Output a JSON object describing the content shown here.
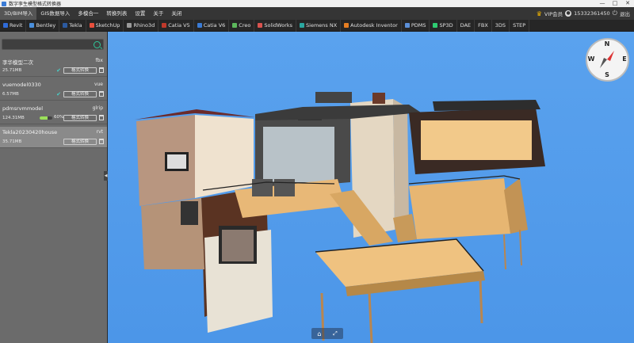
{
  "window": {
    "title": "数字孪生模型格式转换器",
    "controls": [
      "—",
      "□",
      "✕"
    ]
  },
  "menu": {
    "items": [
      "3D/BIM导入",
      "GIS数据导入",
      "多模合一",
      "转换列表",
      "设置",
      "关于",
      "关闭"
    ],
    "vip_label": "VIP会员",
    "phone": "15332361450",
    "logout": "退出"
  },
  "toolbar": {
    "items": [
      {
        "label": "Revit",
        "color": "#2f6bd8"
      },
      {
        "label": "Bentley",
        "color": "#4a8fdc"
      },
      {
        "label": "Tekla",
        "color": "#2c5aa0"
      },
      {
        "label": "SketchUp",
        "color": "#e84f3c"
      },
      {
        "label": "Rhino3d",
        "color": "#9a9a9a"
      },
      {
        "label": "Catia V5",
        "color": "#c0392b"
      },
      {
        "label": "Catia V6",
        "color": "#3a7bd5"
      },
      {
        "label": "Creo",
        "color": "#5cb85c"
      },
      {
        "label": "SolidWorks",
        "color": "#d9534f"
      },
      {
        "label": "Siemens NX",
        "color": "#2aa7a0"
      },
      {
        "label": "Autodesk Inventor",
        "color": "#e67e22"
      },
      {
        "label": "PDMS",
        "color": "#5b8fd8"
      },
      {
        "label": "SP3D",
        "color": "#2ecc71"
      },
      {
        "label": "DAE",
        "color": ""
      },
      {
        "label": "FBX",
        "color": ""
      },
      {
        "label": "3DS",
        "color": ""
      },
      {
        "label": "STEP",
        "color": ""
      }
    ]
  },
  "sidebar": {
    "search": {
      "placeholder": "",
      "value": ""
    },
    "convert_label": "格式转换",
    "models": [
      {
        "name": "李华模型二次",
        "ext": "fbx",
        "size": "25.71MB",
        "progress": null,
        "selected": false
      },
      {
        "name": "vuemodel0330",
        "ext": "vue",
        "size": "6.57MB",
        "progress": null,
        "selected": false
      },
      {
        "name": "pdmsrvmmodel",
        "ext": "glrip",
        "size": "124.31MB",
        "progress": 60,
        "progress_label": "60%",
        "selected": false
      },
      {
        "name": "Tekla20230420house",
        "ext": "rvt",
        "size": "35.71MB",
        "progress": null,
        "selected": true
      }
    ]
  },
  "compass": {
    "n": "N",
    "e": "E",
    "s": "S",
    "w": "W"
  },
  "colors": {
    "accent": "#2fc89a",
    "check": "#49d0c8",
    "sky": "#5aa2ee",
    "progress": "#9be05a"
  }
}
